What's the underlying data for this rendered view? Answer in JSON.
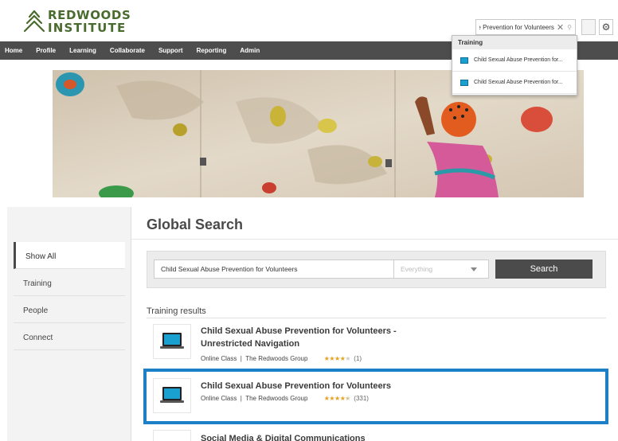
{
  "brand": {
    "line1": "REDWOODS",
    "line2": "INSTITUTE",
    "color": "#4a6b2e"
  },
  "header": {
    "search_value": "Child Sexual Abuse Prevention for Volunteers",
    "clear_icon": "close-icon",
    "search_icon": "search-icon",
    "settings_icon": "gear-icon"
  },
  "nav": {
    "items": [
      "Home",
      "Profile",
      "Learning",
      "Collaborate",
      "Support",
      "Reporting",
      "Admin"
    ]
  },
  "typeahead": {
    "header": "Training",
    "items": [
      "Child Sexual Abuse Prevention for...",
      "Child Sexual Abuse Prevention for..."
    ]
  },
  "sidebar": {
    "items": [
      "Show All",
      "Training",
      "People",
      "Connect"
    ],
    "active": "Show All"
  },
  "page": {
    "title": "Global Search"
  },
  "search": {
    "query": "Child Sexual Abuse Prevention for Volunteers",
    "scope": "Everything",
    "button": "Search"
  },
  "results": {
    "heading": "Training results",
    "items": [
      {
        "title_line1": "Child Sexual Abuse Prevention for Volunteers -",
        "title_line2": "Unrestricted Navigation",
        "type": "Online Class",
        "provider": "The Redwoods Group",
        "rating": 4,
        "count": "(1)"
      },
      {
        "title_line1": "Child Sexual Abuse Prevention for Volunteers",
        "type": "Online Class",
        "provider": "The Redwoods Group",
        "rating": 4.5,
        "count": "(331)"
      },
      {
        "title_line1": "Social Media & Digital Communications"
      }
    ]
  },
  "colors": {
    "nav_bg": "#4d4d4d",
    "highlight": "#1d7fc6",
    "star": "#e6a11f",
    "typeahead_icon": "#1a9fd1"
  }
}
